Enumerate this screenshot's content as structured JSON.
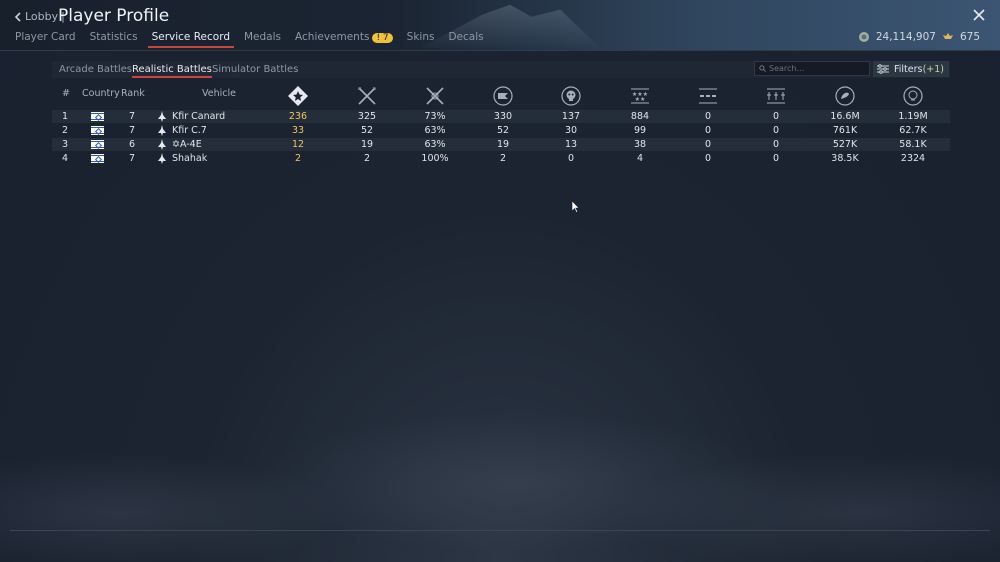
{
  "header": {
    "back_label": "Lobby",
    "separator": "|",
    "title": "Player Profile",
    "tabs": [
      {
        "label": "Player Card"
      },
      {
        "label": "Statistics"
      },
      {
        "label": "Service Record"
      },
      {
        "label": "Medals"
      },
      {
        "label": "Achievements",
        "badge_left": "!",
        "badge_count": "7"
      },
      {
        "label": "Skins"
      },
      {
        "label": "Decals"
      }
    ],
    "active_tab": "Service Record",
    "silver_lions": "24,114,907",
    "golden_eagles": "675"
  },
  "mode_tabs": [
    {
      "label": "Arcade Battles"
    },
    {
      "label": "Realistic Battles"
    },
    {
      "label": "Simulator Battles"
    }
  ],
  "active_mode": "Realistic Battles",
  "search": {
    "placeholder": "Search..."
  },
  "filters": {
    "label": "Filters",
    "count": "(+1)"
  },
  "table": {
    "columns": {
      "num": "#",
      "country": "Country",
      "rank": "Rank",
      "vehicle": "Vehicle"
    },
    "stat_icons": [
      "battles-icon",
      "respawns-icon",
      "victories-icon",
      "missions-icon",
      "deaths-icon",
      "air-kills-icon",
      "ground-kills-icon",
      "naval-kills-icon",
      "exp-icon",
      "silver-icon"
    ],
    "rows": [
      {
        "num": "1",
        "rank": "7",
        "vehicle": "Kfir Canard",
        "stats": [
          "236",
          "325",
          "73%",
          "330",
          "137",
          "884",
          "0",
          "0",
          "16.6M",
          "1.19M"
        ]
      },
      {
        "num": "2",
        "rank": "7",
        "vehicle": "Kfir C.7",
        "stats": [
          "33",
          "52",
          "63%",
          "52",
          "30",
          "99",
          "0",
          "0",
          "761K",
          "62.7K"
        ]
      },
      {
        "num": "3",
        "rank": "6",
        "vehicle": "✡A-4E",
        "stats": [
          "12",
          "19",
          "63%",
          "19",
          "13",
          "38",
          "0",
          "0",
          "527K",
          "58.1K"
        ]
      },
      {
        "num": "4",
        "rank": "7",
        "vehicle": "Shahak",
        "stats": [
          "2",
          "2",
          "100%",
          "2",
          "0",
          "4",
          "0",
          "0",
          "38.5K",
          "2324"
        ]
      }
    ]
  },
  "colors": {
    "accent_red": "#c8463c",
    "gold": "#f2c555",
    "background": "#1c2431"
  }
}
